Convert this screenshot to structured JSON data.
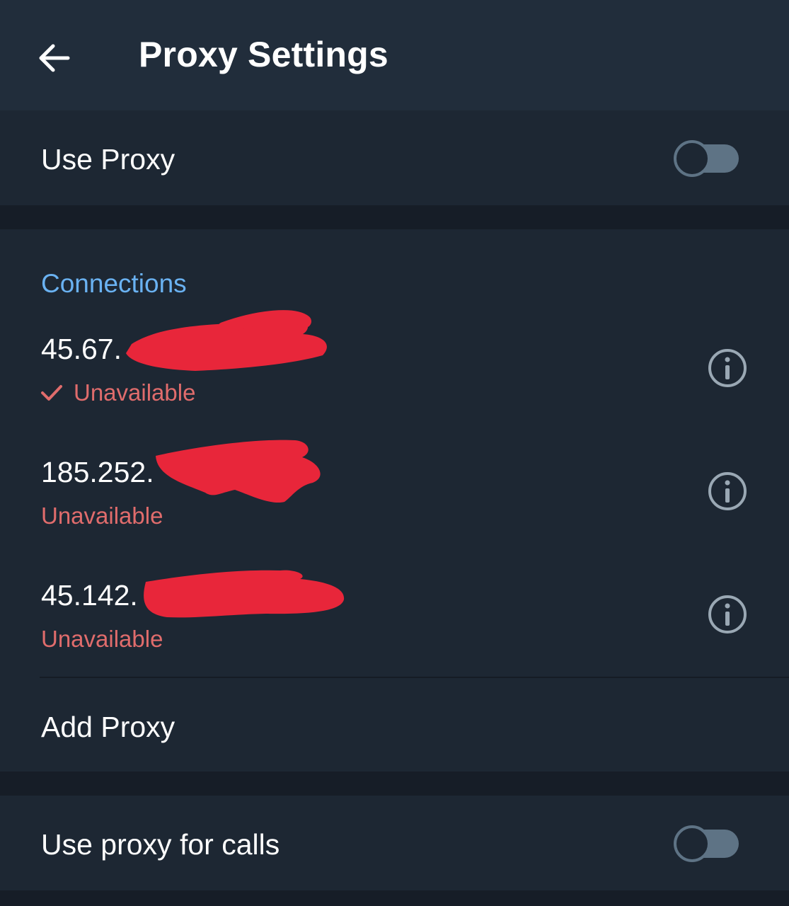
{
  "header": {
    "title": "Proxy Settings",
    "back_icon": "arrow-left-icon"
  },
  "use_proxy": {
    "label": "Use Proxy",
    "enabled": false
  },
  "connections": {
    "header": "Connections",
    "items": [
      {
        "address": "45.67.",
        "status": "Unavailable",
        "selected": true,
        "info_icon": "info-icon"
      },
      {
        "address": "185.252.",
        "status": "Unavailable",
        "selected": false,
        "info_icon": "info-icon"
      },
      {
        "address": "45.142.",
        "status": "Unavailable",
        "selected": false,
        "info_icon": "info-icon"
      }
    ],
    "add_label": "Add Proxy"
  },
  "calls_proxy": {
    "label": "Use proxy for calls",
    "enabled": false
  },
  "colors": {
    "background": "#161d27",
    "header": "#212d3b",
    "section": "#1d2733",
    "accent": "#6ab2f2",
    "error": "#e06c6c",
    "toggle_off": "#5e7385",
    "redaction": "#e8263a"
  }
}
